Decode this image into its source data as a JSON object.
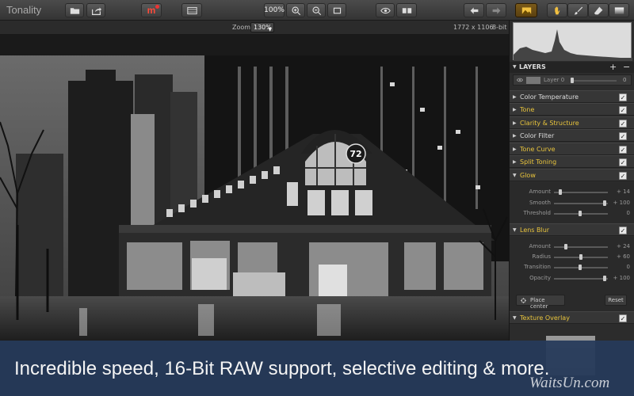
{
  "app": {
    "title": "Tonality"
  },
  "toolbar": {
    "zoom_level": "100%",
    "mask_label": "m"
  },
  "infobar": {
    "zoom_label": "Zoom",
    "zoom_value": "130%",
    "dimensions": "1772 x 1106",
    "bit_depth": "8-bit"
  },
  "photo": {
    "sign_number": "72"
  },
  "layers": {
    "title": "LAYERS",
    "add": "+",
    "remove": "−",
    "layer_name": "Layer 0",
    "opacity_value": "0"
  },
  "sections": [
    {
      "label": "Color Temperature",
      "active": false
    },
    {
      "label": "Tone",
      "active": true
    },
    {
      "label": "Clarity & Structure",
      "active": true
    },
    {
      "label": "Color Filter",
      "active": false
    },
    {
      "label": "Tone Curve",
      "active": true
    },
    {
      "label": "Split Toning",
      "active": true
    },
    {
      "label": "Glow",
      "active": true
    },
    {
      "label": "Lens Blur",
      "active": true
    },
    {
      "label": "Texture Overlay",
      "active": true
    }
  ],
  "glow": {
    "sliders": [
      {
        "label": "Amount",
        "value": "+ 14",
        "position": 0.1
      },
      {
        "label": "Smooth",
        "value": "+ 100",
        "position": 0.97
      },
      {
        "label": "Threshold",
        "value": "0",
        "position": 0.48
      }
    ]
  },
  "lens_blur": {
    "sliders": [
      {
        "label": "Amount",
        "value": "+ 24",
        "position": 0.2
      },
      {
        "label": "Radius",
        "value": "+ 60",
        "position": 0.5
      },
      {
        "label": "Transition",
        "value": "0",
        "position": 0.48
      },
      {
        "label": "Opacity",
        "value": "+ 100",
        "position": 0.97
      }
    ],
    "place_center": "Place center",
    "reset": "Reset"
  },
  "check_mark": "✓",
  "banner": {
    "text": "Incredible speed, 16-Bit RAW support, selective editing & more.",
    "watermark": "WaitsUn.com"
  },
  "colors": {
    "accent": "#e8c43c",
    "banner": "#263a5a"
  }
}
